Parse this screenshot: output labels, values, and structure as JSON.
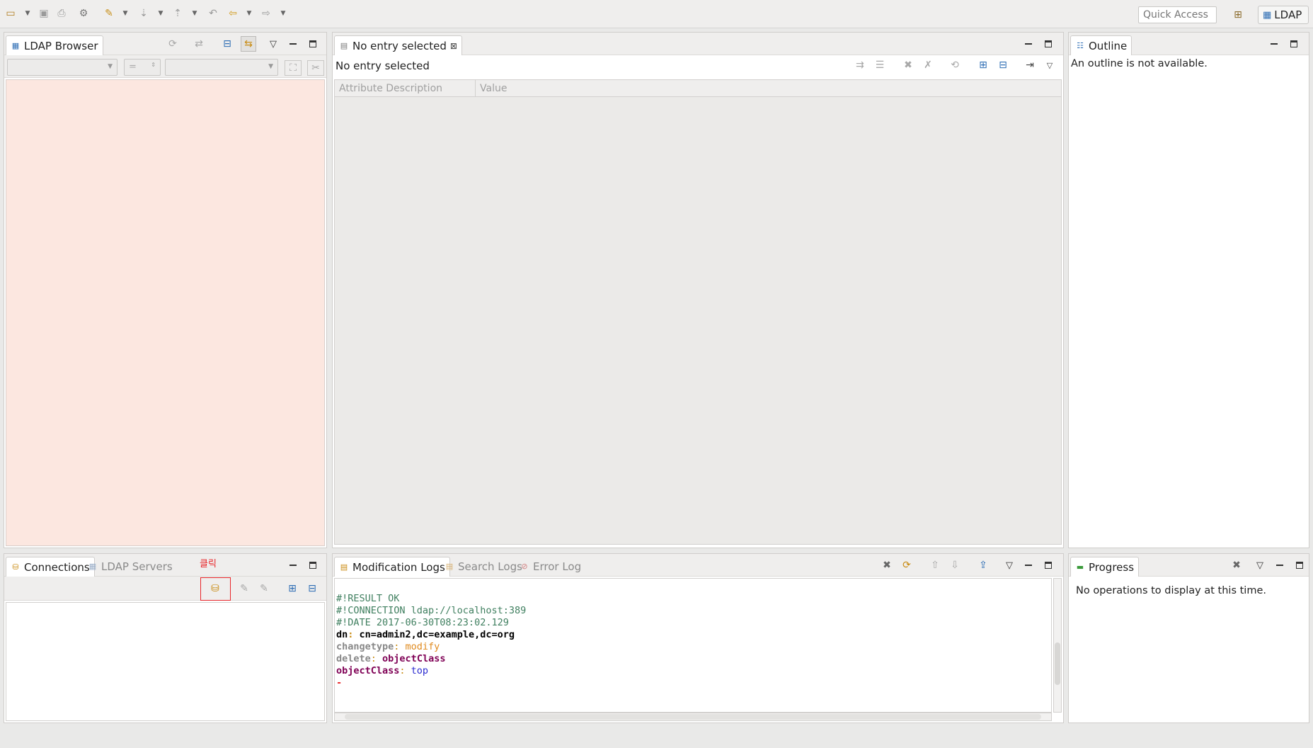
{
  "toolbar": {
    "quick_access_placeholder": "Quick Access",
    "perspective_label": "LDAP",
    "icons": [
      "new-icon",
      "save-icon",
      "save-all-icon",
      "print-icon",
      "settings-icon",
      "run-icon",
      "next-annotation-icon",
      "prev-annotation-icon",
      "last-edit-icon",
      "back-icon",
      "forward-icon"
    ]
  },
  "ldap_browser": {
    "tab_label": "LDAP Browser",
    "filter_operator": "="
  },
  "entry_editor": {
    "tab_label": "No entry selected",
    "header_text": "No entry selected",
    "columns": [
      "Attribute Description",
      "Value"
    ]
  },
  "outline": {
    "tab_label": "Outline",
    "message": "An outline is not available."
  },
  "connections": {
    "tabs": [
      "Connections",
      "LDAP Servers"
    ],
    "annotation": "클릭"
  },
  "logs": {
    "tabs": [
      "Modification Logs",
      "Search Logs",
      "Error Log"
    ],
    "lines": [
      {
        "text": "#!RESULT OK",
        "color": "#3f7f5f"
      },
      {
        "text": "#!CONNECTION ldap://localhost:389",
        "color": "#3f7f5f"
      },
      {
        "text": "#!DATE 2017-06-30T08:23:02.129",
        "color": "#3f7f5f"
      }
    ],
    "dn_key": "dn",
    "dn_value": "cn=admin2,dc=example,dc=org",
    "changetype_key": "changetype",
    "changetype_value": "modify",
    "delete_key": "delete",
    "delete_value": "objectClass",
    "objectclass_key": "objectClass",
    "objectclass_value": "top",
    "separator": "-"
  },
  "progress": {
    "tab_label": "Progress",
    "message": "No operations to display at this time."
  },
  "colors": {
    "browser_bg": "#fce7e0",
    "annotation_red": "#e8262a",
    "comment_green": "#3f7f5f",
    "keyword_purple": "#7f0055",
    "value_orange": "#e08a1e",
    "value_blue": "#2a2ad0"
  }
}
